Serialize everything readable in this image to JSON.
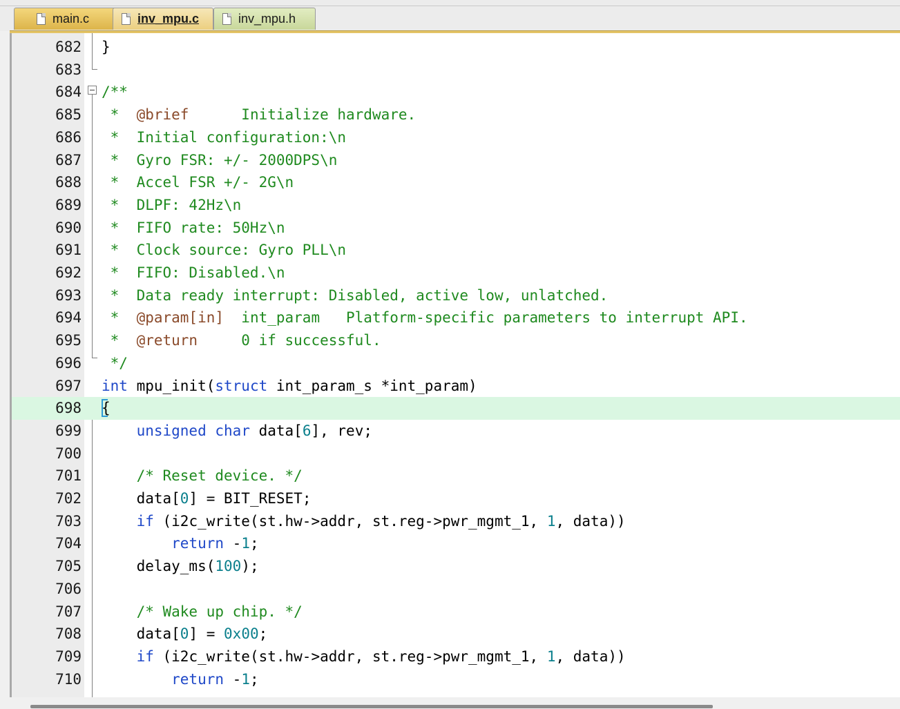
{
  "tabs": [
    {
      "label": "main.c",
      "icon": "c-file-icon"
    },
    {
      "label": "inv_mpu.c",
      "icon": "c-file-icon",
      "active": true
    },
    {
      "label": "inv_mpu.h",
      "icon": "h-file-icon"
    }
  ],
  "line_numbers": [
    "682",
    "683",
    "684",
    "685",
    "686",
    "687",
    "688",
    "689",
    "690",
    "691",
    "692",
    "693",
    "694",
    "695",
    "696",
    "697",
    "698",
    "699",
    "700",
    "701",
    "702",
    "703",
    "704",
    "705",
    "706",
    "707",
    "708",
    "709",
    "710"
  ],
  "code": {
    "l682": "}",
    "l684": "/**",
    "l685_a": " *  ",
    "l685_tag": "@brief",
    "l685_b": "      Initialize hardware.",
    "l686": " *  Initial configuration:\\n",
    "l687": " *  Gyro FSR: +/- 2000DPS\\n",
    "l688": " *  Accel FSR +/- 2G\\n",
    "l689": " *  DLPF: 42Hz\\n",
    "l690": " *  FIFO rate: 50Hz\\n",
    "l691": " *  Clock source: Gyro PLL\\n",
    "l692": " *  FIFO: Disabled.\\n",
    "l693": " *  Data ready interrupt: Disabled, active low, unlatched.",
    "l694_a": " *  ",
    "l694_tag": "@param[in]",
    "l694_b": "  int_param   Platform-specific parameters to interrupt API.",
    "l695_a": " *  ",
    "l695_tag": "@return",
    "l695_b": "     0 if successful.",
    "l696": " */",
    "l697_kw1": "int",
    "l697_a": " mpu_init(",
    "l697_kw2": "struct",
    "l697_b": " int_param_s *int_param)",
    "l698": "{",
    "l699_indent": "    ",
    "l699_kw1": "unsigned",
    "l699_sp": " ",
    "l699_kw2": "char",
    "l699_a": " data[",
    "l699_n": "6",
    "l699_b": "], rev;",
    "l701": "    /* Reset device. */",
    "l702_a": "    data[",
    "l702_n": "0",
    "l702_b": "] = BIT_RESET;",
    "l703_indent": "    ",
    "l703_kw": "if",
    "l703_a": " (i2c_write(st.hw->addr, st.reg->pwr_mgmt_1, ",
    "l703_n": "1",
    "l703_b": ", data))",
    "l704_indent": "        ",
    "l704_kw": "return",
    "l704_a": " -",
    "l704_n": "1",
    "l704_b": ";",
    "l705_a": "    delay_ms(",
    "l705_n": "100",
    "l705_b": ");",
    "l707": "    /* Wake up chip. */",
    "l708_a": "    data[",
    "l708_n1": "0",
    "l708_b": "] = ",
    "l708_n2": "0x00",
    "l708_c": ";",
    "l709_indent": "    ",
    "l709_kw": "if",
    "l709_a": " (i2c_write(st.hw->addr, st.reg->pwr_mgmt_1, ",
    "l709_n": "1",
    "l709_b": ", data))",
    "l710_indent": "        ",
    "l710_kw": "return",
    "l710_a": " -",
    "l710_n": "1",
    "l710_b": ";"
  },
  "colors": {
    "keyword": "#1f48c8",
    "number": "#0a7f8c",
    "comment": "#1f8a1f",
    "doc_tag": "#8a4a2a",
    "current_line": "#daf7e2"
  }
}
